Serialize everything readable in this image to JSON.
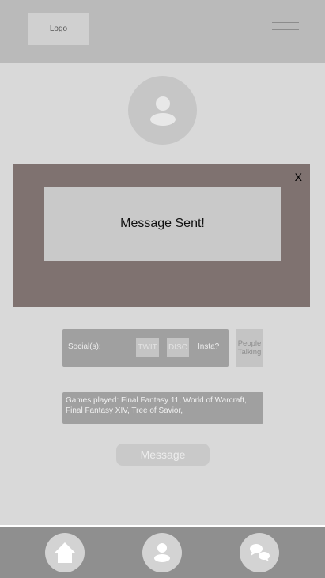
{
  "header": {
    "logo_label": "Logo",
    "menu_icon": "hamburger-menu-icon"
  },
  "profile": {
    "avatar_icon": "user-icon"
  },
  "modal": {
    "close_label": "X",
    "message": "Message Sent!"
  },
  "socials": {
    "label": "Social(s):",
    "twit_label": "TWIT",
    "disc_label": "DISC",
    "insta_label": "Insta?"
  },
  "people_talking": {
    "line1": "People",
    "line2": "Talking"
  },
  "games": {
    "text": "Games played: Final Fantasy 11, World of Warcraft, Final Fantasy XIV, Tree of Savior,"
  },
  "message_button": {
    "label": "Message"
  },
  "bottom_nav": {
    "items": [
      {
        "icon": "home-icon"
      },
      {
        "icon": "profile-icon"
      },
      {
        "icon": "chat-icon"
      }
    ]
  },
  "colors": {
    "background": "#d9d9d9",
    "header": "#bababa",
    "modal_overlay": "#7f7270",
    "modal_box": "#c9c9c9",
    "panel": "#a0a0a0",
    "bottom_nav": "#8f8f8f"
  }
}
